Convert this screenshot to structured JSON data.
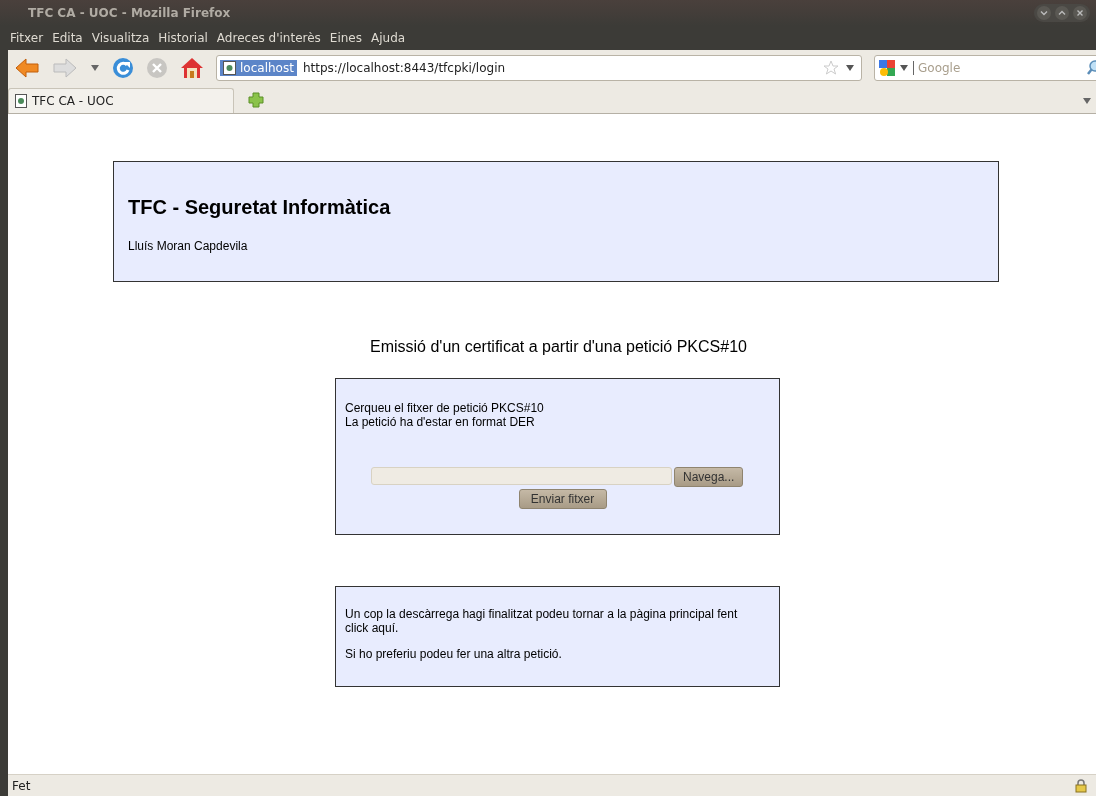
{
  "window": {
    "title": "TFC CA - UOC - Mozilla Firefox"
  },
  "menu": [
    "Fitxer",
    "Edita",
    "Visualitza",
    "Historial",
    "Adreces d'interès",
    "Eines",
    "Ajuda"
  ],
  "toolbar": {
    "address": {
      "identity": "localhost",
      "url": "https://localhost:8443/tfcpki/login"
    },
    "search": {
      "placeholder": "Google"
    }
  },
  "tabs": [
    {
      "label": "TFC CA - UOC",
      "selected": true
    }
  ],
  "page": {
    "header": {
      "title": "TFC - Seguretat Informàtica",
      "author": "Lluís Moran Capdevila"
    },
    "heading": "Emissió d'un certificat a partir d'una petició PKCS#10",
    "upload": {
      "lines": [
        "Cerqueu el fitxer de petició PKCS#10",
        "La petició ha d'estar en format DER"
      ],
      "browse_button": "Navega...",
      "submit_button": "Enviar fitxer"
    },
    "info": {
      "paragraphs": [
        "Un cop la descàrrega hagi finalitzat podeu tornar a la pàgina principal fent click aquí.",
        "Si ho preferiu podeu  fer una altra petició."
      ]
    }
  },
  "status_bar": {
    "text": "Fet"
  }
}
